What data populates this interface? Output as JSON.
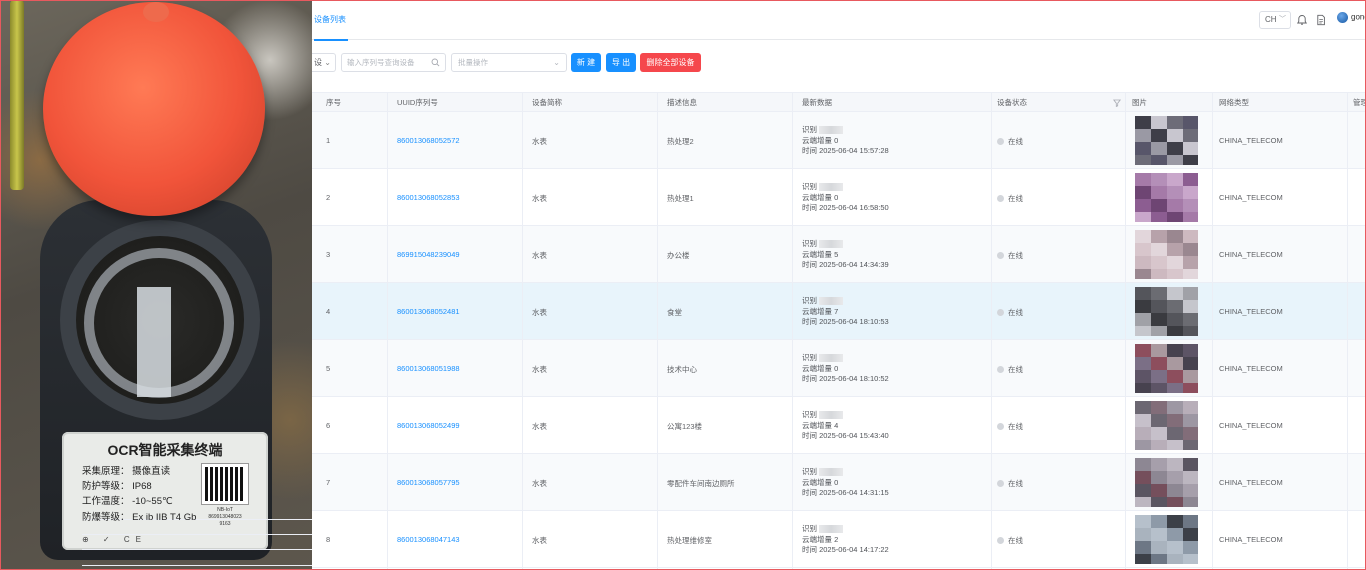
{
  "photo": {
    "label_title": "OCR智能采集终端",
    "label_lines": [
      "采集原理：  摄像直读",
      "防护等级：  IP68",
      "工作温度：  -10~55℃",
      "防爆等级：  Ex ib IIB T4 Gb"
    ],
    "qr_text_1": "NB-IoT",
    "qr_text_2": "869913048023",
    "qr_text_3": "9163",
    "marks": "⊕ ✓ CE"
  },
  "header": {
    "active_tab": "设备列表",
    "lang": "CH",
    "user": "gong"
  },
  "toolbar": {
    "select_value": "设",
    "search_placeholder": "输入序列号查询设备",
    "batch_placeholder": "批量操作",
    "new_label": "新 建",
    "export_label": "导 出",
    "delete_all_label": "删除全部设备"
  },
  "table": {
    "columns": [
      "序号",
      "UUID序列号",
      "设备简称",
      "描述信息",
      "最新数据",
      "设备状态",
      "图片",
      "网络类型",
      "管理"
    ],
    "latest_labels": {
      "recog": "识别",
      "cloud": "云端增量",
      "time": "时间"
    },
    "rows": [
      {
        "idx": "1",
        "uuid": "860013068052572",
        "name": "水表",
        "desc": "热处理2",
        "cloud": "0",
        "time": "2025-06-04 15:57:28",
        "status": "在线",
        "network": "CHINA_TELECOM"
      },
      {
        "idx": "2",
        "uuid": "860013068052853",
        "name": "水表",
        "desc": "热处理1",
        "cloud": "0",
        "time": "2025-06-04 16:58:50",
        "status": "在线",
        "network": "CHINA_TELECOM"
      },
      {
        "idx": "3",
        "uuid": "869915048239049",
        "name": "水表",
        "desc": "办公楼",
        "cloud": "5",
        "time": "2025-06-04 14:34:39",
        "status": "在线",
        "network": "CHINA_TELECOM"
      },
      {
        "idx": "4",
        "uuid": "860013068052481",
        "name": "水表",
        "desc": "食堂",
        "cloud": "7",
        "time": "2025-06-04 18:10:53",
        "status": "在线",
        "network": "CHINA_TELECOM"
      },
      {
        "idx": "5",
        "uuid": "860013068051988",
        "name": "水表",
        "desc": "技术中心",
        "cloud": "0",
        "time": "2025-06-04 18:10:52",
        "status": "在线",
        "network": "CHINA_TELECOM"
      },
      {
        "idx": "6",
        "uuid": "860013068052499",
        "name": "水表",
        "desc": "公寓123楼",
        "cloud": "4",
        "time": "2025-06-04 15:43:40",
        "status": "在线",
        "network": "CHINA_TELECOM"
      },
      {
        "idx": "7",
        "uuid": "860013068057795",
        "name": "水表",
        "desc": "零配件车间南边厕所",
        "cloud": "0",
        "time": "2025-06-04 14:31:15",
        "status": "在线",
        "network": "CHINA_TELECOM"
      },
      {
        "idx": "8",
        "uuid": "860013068047143",
        "name": "水表",
        "desc": "热处理维修室",
        "cloud": "2",
        "time": "2025-06-04 14:17:22",
        "status": "在线",
        "network": "CHINA_TELECOM"
      }
    ]
  },
  "colors": {
    "accent": "#1890ff",
    "danger": "#f5474c",
    "cap_red": "#f1543a",
    "highlight_row": "#e8f4fb"
  },
  "icons": [
    "search-icon",
    "filter-icon",
    "bell-icon",
    "document-icon",
    "chevron-down-icon",
    "avatar"
  ]
}
